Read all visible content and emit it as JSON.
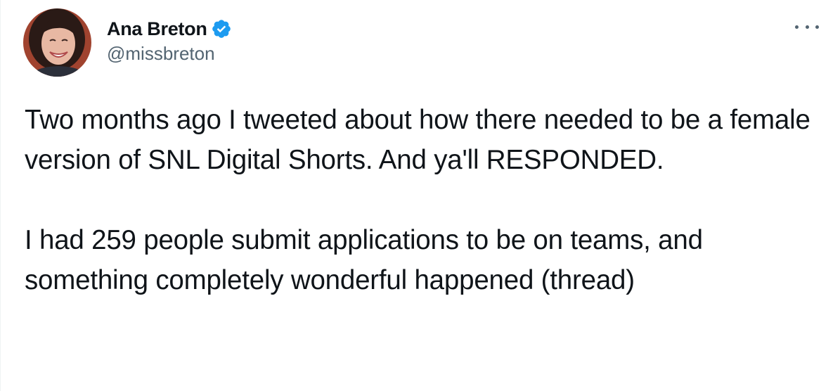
{
  "tweet": {
    "author": {
      "display_name": "Ana Breton",
      "handle": "@missbreton",
      "verified": true
    },
    "text": {
      "paragraph_1": "Two months ago I tweeted about how there needed to be a female version of SNL Digital Shorts. And ya'll RESPONDED.",
      "paragraph_2": "I had 259 people submit applications to be on teams, and something completely wonderful happened (thread)"
    },
    "icons": {
      "verified": "verified-badge-icon",
      "more": "more-options-icon"
    },
    "colors": {
      "verified_blue": "#1d9bf0",
      "text": "#0f1419",
      "secondary_text": "#536471"
    }
  }
}
